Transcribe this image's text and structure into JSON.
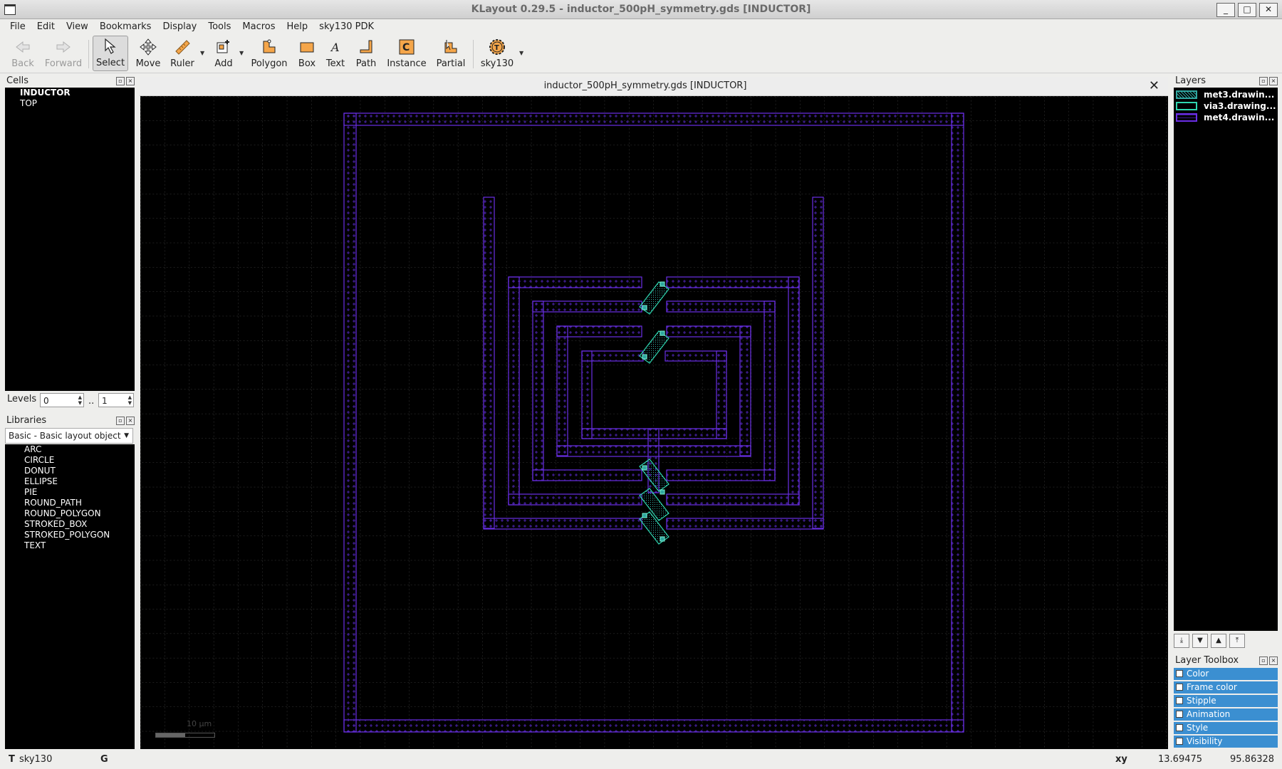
{
  "window": {
    "title": "KLayout 0.29.5 - inductor_500pH_symmetry.gds [INDUCTOR]",
    "buttons": {
      "minimize": "_",
      "maximize": "□",
      "close": "✕"
    }
  },
  "menu": [
    "File",
    "Edit",
    "View",
    "Bookmarks",
    "Display",
    "Tools",
    "Macros",
    "Help",
    "sky130 PDK"
  ],
  "toolbar": {
    "back": "Back",
    "forward": "Forward",
    "select": "Select",
    "move": "Move",
    "ruler": "Ruler",
    "add": "Add",
    "polygon": "Polygon",
    "box": "Box",
    "text": "Text",
    "path": "Path",
    "instance": "Instance",
    "partial": "Partial",
    "sky130": "sky130"
  },
  "cells": {
    "title": "Cells",
    "items": [
      "INDUCTOR",
      "TOP"
    ],
    "levels_label": "Levels",
    "levels_from": "0",
    "levels_sep": "..",
    "levels_to": "1"
  },
  "libraries": {
    "title": "Libraries",
    "selected": "Basic - Basic layout object",
    "items": [
      "ARC",
      "CIRCLE",
      "DONUT",
      "ELLIPSE",
      "PIE",
      "ROUND_PATH",
      "ROUND_POLYGON",
      "STROKED_BOX",
      "STROKED_POLYGON",
      "TEXT"
    ]
  },
  "view": {
    "tab_title": "inductor_500pH_symmetry.gds [INDUCTOR]",
    "close": "✕",
    "scale_label": "10  µm",
    "colors": {
      "met4": "#6a2ee6",
      "via3": "#2fd6b0",
      "background": "#000000"
    }
  },
  "layers": {
    "title": "Layers",
    "items": [
      {
        "name": "met3.drawin...",
        "color": "#2fa7a0"
      },
      {
        "name": "via3.drawing...",
        "color": "#2fd6b0"
      },
      {
        "name": "met4.drawin...",
        "color": "#6a2ee6"
      }
    ]
  },
  "layer_toolbox": {
    "title": "Layer Toolbox",
    "items": [
      "Color",
      "Frame color",
      "Stipple",
      "Animation",
      "Style",
      "Visibility"
    ]
  },
  "status": {
    "tech_prefix": "T",
    "tech": "sky130",
    "grid_flag": "G",
    "coord_label": "xy",
    "x": "13.69475",
    "y": "95.86328"
  }
}
